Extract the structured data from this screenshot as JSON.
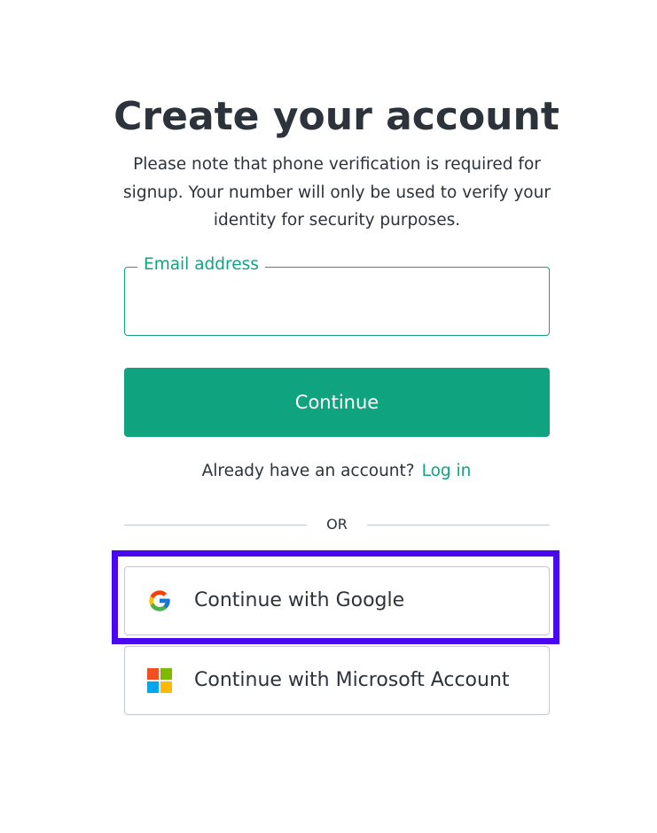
{
  "page": {
    "title": "Create your account",
    "subtitle": "Please note that phone verification is required for signup. Your number will only be used to verify your identity for security purposes."
  },
  "form": {
    "email_label": "Email address",
    "email_value": "",
    "continue_label": "Continue"
  },
  "login": {
    "prompt": "Already have an account?",
    "link_label": "Log in"
  },
  "divider": {
    "label": "OR"
  },
  "social": {
    "google": {
      "label": "Continue with Google",
      "icon": "google-logo-icon"
    },
    "microsoft": {
      "label": "Continue with Microsoft Account",
      "icon": "microsoft-logo-icon"
    }
  },
  "colors": {
    "accent": "#10a37f",
    "text": "#2d333a",
    "border": "#c2c8d0",
    "highlight": "#4a08f0"
  }
}
